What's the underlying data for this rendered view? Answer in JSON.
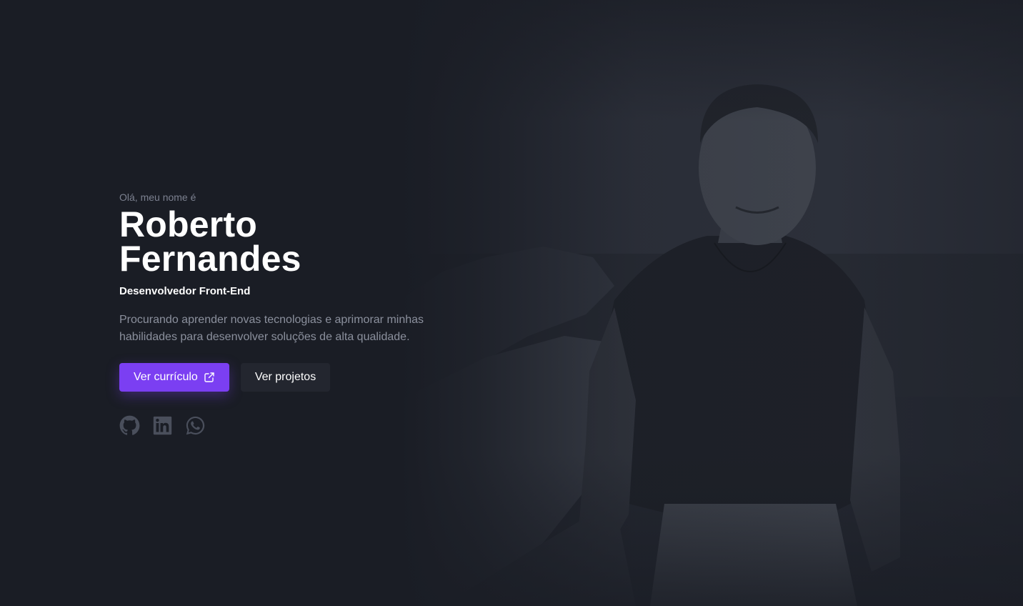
{
  "hero": {
    "greeting": "Olá, meu nome é",
    "name_line1": "Roberto",
    "name_line2": "Fernandes",
    "role": "Desenvolvedor Front-End",
    "description": "Procurando aprender novas tecnologias e aprimorar minhas habilidades para desenvolver soluções de alta qualidade."
  },
  "actions": {
    "resume_label": "Ver currículo",
    "projects_label": "Ver projetos"
  },
  "socials": [
    {
      "icon": "github-icon"
    },
    {
      "icon": "linkedin-icon"
    },
    {
      "icon": "whatsapp-icon"
    }
  ],
  "colors": {
    "background": "#1a1d25",
    "accent": "#7b3ff2",
    "secondary_button": "#23262f",
    "muted_text": "#8b909d",
    "social_icon": "#4a4f5c"
  }
}
